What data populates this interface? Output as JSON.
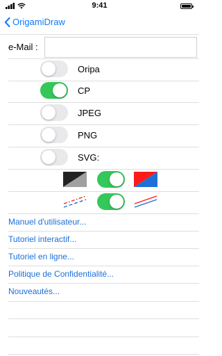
{
  "status_bar": {
    "time": "9:41"
  },
  "nav": {
    "back_label": "OrigamiDraw"
  },
  "email": {
    "label": "e-Mail :",
    "value": "",
    "placeholder": ""
  },
  "switches": [
    {
      "label": "Oripa",
      "on": false
    },
    {
      "label": "CP",
      "on": true
    },
    {
      "label": "JPEG",
      "on": false
    },
    {
      "label": "PNG",
      "on": false
    },
    {
      "label": "SVG:",
      "on": false
    }
  ],
  "color_option": {
    "on": true,
    "left_icon": "gray-black-diagonal-tile",
    "right_icon": "red-blue-diagonal-tile",
    "colors": {
      "red": "#ff1a1a",
      "blue": "#1f6fd6",
      "black": "#222222",
      "gray": "#a0a0a0"
    }
  },
  "line_option": {
    "on": true,
    "left_icon": "red-blue-dashed-lines",
    "right_icon": "red-blue-solid-lines"
  },
  "links": [
    "Manuel d'utilisateur...",
    "Tutoriel interactif...",
    "Tutoriel en ligne...",
    "Politique de Confidentialité...",
    "Nouveautés..."
  ],
  "colors": {
    "accent": "#0a7aff",
    "switch_on": "#34c759",
    "switch_off": "#e9e9eb",
    "link": "#1a6fd8"
  }
}
